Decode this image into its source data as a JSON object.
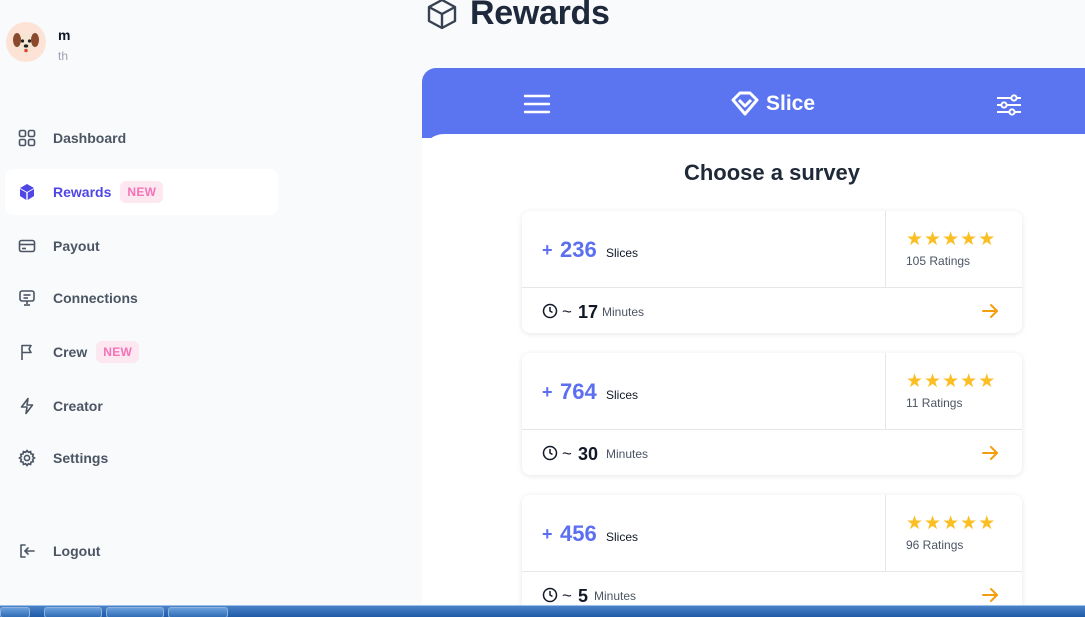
{
  "profile": {
    "name": "m",
    "subtitle": "th"
  },
  "nav": {
    "dashboard": "Dashboard",
    "rewards": "Rewards",
    "rewards_badge": "NEW",
    "payout": "Payout",
    "connections": "Connections",
    "crew": "Crew",
    "crew_badge": "NEW",
    "creator": "Creator",
    "settings": "Settings",
    "logout": "Logout"
  },
  "header": {
    "title": "Rewards"
  },
  "slice": {
    "logo_text": "Slice",
    "heading": "Choose a survey",
    "surveys": [
      {
        "plus": "+",
        "slices": "236",
        "slices_label": "Slices",
        "rating_stars": 5,
        "ratings": "105 Ratings",
        "tilde": "~",
        "minutes": "17",
        "minutes_label": "Minutes"
      },
      {
        "plus": "+",
        "slices": "764",
        "slices_label": "Slices",
        "rating_stars": 5,
        "ratings": "11 Ratings",
        "tilde": "~",
        "minutes": "30",
        "minutes_label": "Minutes"
      },
      {
        "plus": "+",
        "slices": "456",
        "slices_label": "Slices",
        "rating_stars": 5,
        "ratings": "96 Ratings",
        "tilde": "~",
        "minutes": "5",
        "minutes_label": "Minutes"
      }
    ]
  },
  "colors": {
    "accent": "#5b75f0",
    "badge_text": "#f472b6",
    "star": "#fbbf24",
    "arrow": "#f59e0b",
    "active_nav": "#4f46e5"
  },
  "icons": [
    "dashboard-icon",
    "cube-icon",
    "card-icon",
    "connections-icon",
    "flag-icon",
    "bolt-icon",
    "gear-icon",
    "logout-icon",
    "menu-icon",
    "slice-logo-icon",
    "filter-icon",
    "clock-icon",
    "arrow-right-icon",
    "star-icon"
  ]
}
